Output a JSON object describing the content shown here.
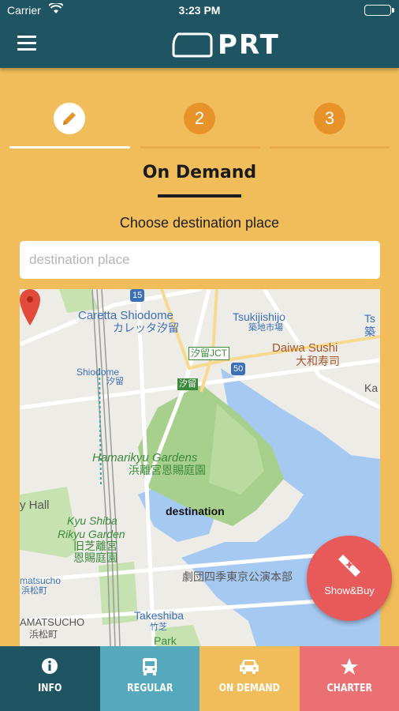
{
  "status": {
    "carrier": "Carrier",
    "time": "3:23 PM"
  },
  "nav": {
    "logo_text": "PRT"
  },
  "steps": [
    {
      "label": ""
    },
    {
      "label": "2"
    },
    {
      "label": "3"
    }
  ],
  "page": {
    "title": "On Demand",
    "subtitle": "Choose destination place"
  },
  "search": {
    "placeholder": "destination place",
    "value": ""
  },
  "map": {
    "labels": {
      "caretta": "Caretta Shiodome",
      "caretta_jp": "カレッタ汐留",
      "tsukijishijo": "Tsukijishijo",
      "tsukijishijo_jp": "築地市場",
      "ts": "Ts",
      "ts_jp": "築",
      "shiodome_jct": "汐留JCT",
      "shiodome": "Shiodome",
      "shiodome_jp": "汐留",
      "shiodome2_jp": "汐留",
      "daiwa": "Daiwa Sushi",
      "daiwa_jp": "大和寿司",
      "ka": "Ka",
      "hamarikyu": "Hamarikyu Gardens",
      "hamarikyu_jp": "浜離宮恩賜庭園",
      "hall": "y Hall",
      "destination": "destination",
      "kyushiba": "Kyu Shiba",
      "kyushiba2": "Rikyu Garden",
      "kyushiba_jp": "旧芝離宮",
      "kyushiba_jp2": "恩賜庭園",
      "shiki": "劇団四季東京公演本部",
      "matsucho": "matsucho",
      "matsucho_jp": "浜松町",
      "takeshiba": "Takeshiba",
      "takeshiba_jp": "竹芝",
      "hamamatsucho": "AMATSUCHO",
      "hamamatsucho_jp": "浜松町",
      "park": "Park",
      "road_15": "15",
      "road_50": "50"
    }
  },
  "fab": {
    "label": "Show&Buy"
  },
  "tabs": [
    {
      "label": "INFO"
    },
    {
      "label": "REGULAR"
    },
    {
      "label": "ON DEMAND"
    },
    {
      "label": "CHARTER"
    }
  ],
  "colors": {
    "header": "#1f5563",
    "background": "#f1bd5a",
    "step_inactive": "#e8922a",
    "fab": "#e8595a",
    "tab_regular": "#55a9bd",
    "tab_charter": "#ea7074"
  }
}
